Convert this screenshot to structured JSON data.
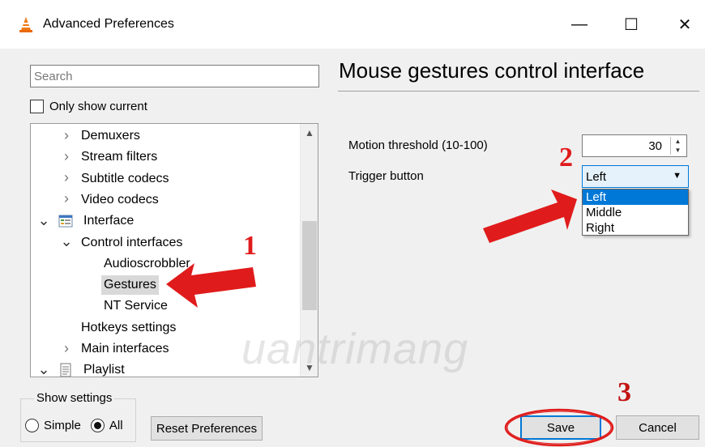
{
  "window": {
    "title": "Advanced Preferences",
    "minimize_glyph": "—",
    "maximize_glyph": "☐",
    "close_glyph": "✕",
    "app_icon": "vlc-cone-icon"
  },
  "search": {
    "placeholder": "Search",
    "value": ""
  },
  "only_show_current": {
    "label": "Only show current",
    "checked": false
  },
  "tree": {
    "items": [
      {
        "label": "Demuxers",
        "level": 1,
        "expander": "collapsed"
      },
      {
        "label": "Stream filters",
        "level": 1,
        "expander": "collapsed"
      },
      {
        "label": "Subtitle codecs",
        "level": 1,
        "expander": "collapsed"
      },
      {
        "label": "Video codecs",
        "level": 1,
        "expander": "collapsed"
      },
      {
        "label": "Interface",
        "level": 0,
        "expander": "expanded",
        "icon": "interface-icon"
      },
      {
        "label": "Control interfaces",
        "level": 1,
        "expander": "expanded"
      },
      {
        "label": "Audioscrobbler",
        "level": 2,
        "expander": "none"
      },
      {
        "label": "Gestures",
        "level": 2,
        "expander": "none",
        "selected": true
      },
      {
        "label": "NT Service",
        "level": 2,
        "expander": "none"
      },
      {
        "label": "Hotkeys settings",
        "level": 1,
        "expander": "none"
      },
      {
        "label": "Main interfaces",
        "level": 1,
        "expander": "collapsed"
      },
      {
        "label": "Playlist",
        "level": 0,
        "expander": "expanded",
        "icon": "playlist-icon"
      }
    ]
  },
  "show_settings": {
    "legend": "Show settings",
    "simple_label": "Simple",
    "all_label": "All",
    "selected": "All"
  },
  "buttons": {
    "reset_label": "Reset Preferences",
    "save_label": "Save",
    "cancel_label": "Cancel"
  },
  "panel": {
    "title": "Mouse gestures control interface",
    "motion_threshold_label": "Motion threshold (10-100)",
    "motion_threshold_value": "30",
    "trigger_button_label": "Trigger button",
    "trigger_button_value": "Left",
    "trigger_options": [
      "Left",
      "Middle",
      "Right"
    ],
    "trigger_highlighted": "Left"
  },
  "annotations": {
    "step1": "1",
    "step2": "2",
    "step3": "3",
    "arrow_color": "#e01b1b",
    "watermark": "uantrimang"
  }
}
